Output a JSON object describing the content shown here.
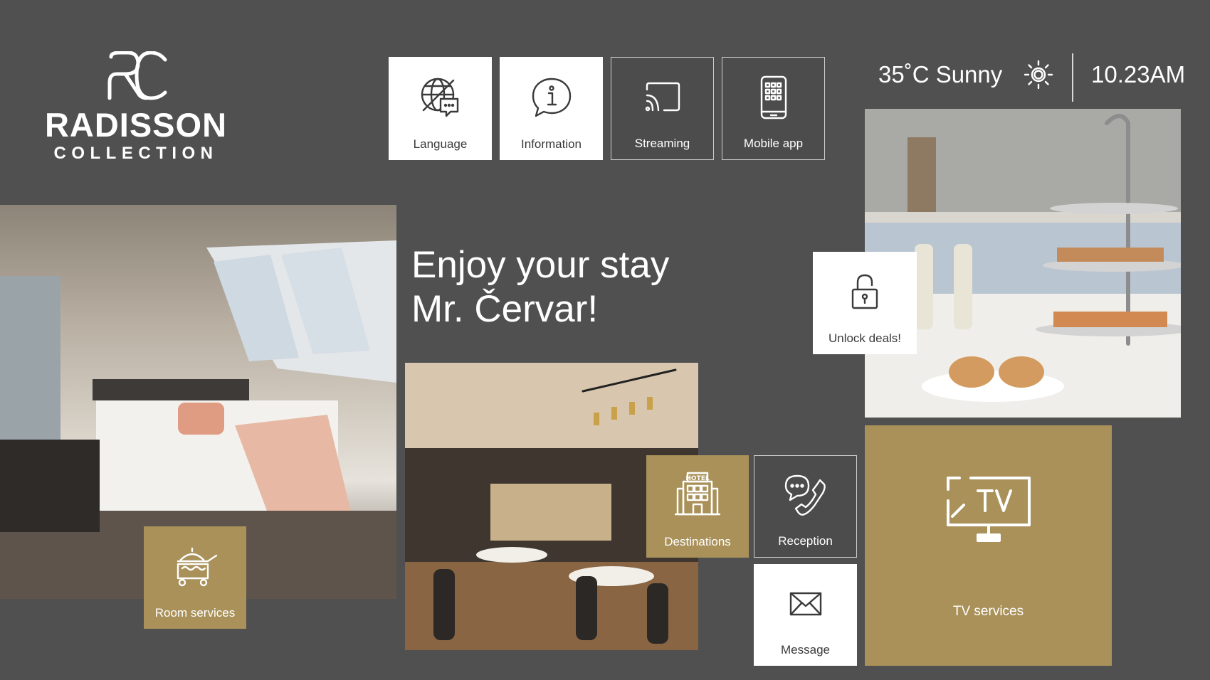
{
  "brand": {
    "name": "RADISSON",
    "subtitle": "COLLECTION"
  },
  "menu": {
    "language": "Language",
    "information": "Information",
    "streaming": "Streaming",
    "mobile_app": "Mobile app",
    "unlock_deals": "Unlock deals!",
    "room_services": "Room services",
    "destinations": "Destinations",
    "reception": "Reception",
    "message": "Message",
    "tv_services": "TV services"
  },
  "status": {
    "weather": "35˚C Sunny",
    "time": "10.23AM"
  },
  "greeting": {
    "line1": "Enjoy your stay",
    "line2": "Mr. Červar!"
  },
  "icons": {
    "language": "globe-chat-icon",
    "information": "info-bubble-icon",
    "streaming": "cast-icon",
    "mobile_app": "phone-grid-icon",
    "unlock_deals": "unlock-icon",
    "room_services": "service-cart-icon",
    "destinations": "hotel-icon",
    "reception": "phone-chat-icon",
    "message": "envelope-icon",
    "tv_services": "tv-icon",
    "weather": "sun-icon"
  },
  "colors": {
    "background": "#505050",
    "gold": "#a99159",
    "tile_white": "#ffffff"
  }
}
